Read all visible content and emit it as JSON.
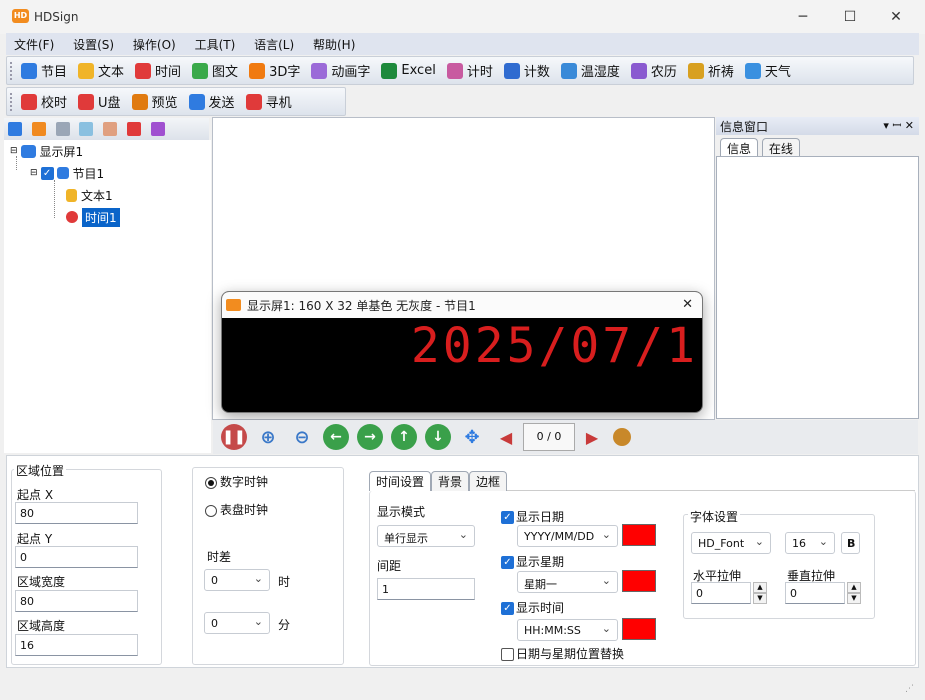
{
  "window": {
    "title": "HDSign",
    "logo": "HD",
    "min": "─",
    "max": "☐",
    "close": "✕"
  },
  "menu": [
    "文件(F)",
    "设置(S)",
    "操作(O)",
    "工具(T)",
    "语言(L)",
    "帮助(H)"
  ],
  "toolbar": [
    {
      "label": "节目",
      "icon": "program-icon",
      "color": "#2f7be0"
    },
    {
      "label": "文本",
      "icon": "text-icon",
      "color": "#f0b428"
    },
    {
      "label": "时间",
      "icon": "clock-icon",
      "color": "#e03a3a"
    },
    {
      "label": "图文",
      "icon": "image-icon",
      "color": "#3aa94a"
    },
    {
      "label": "3D字",
      "icon": "3d-text-icon",
      "color": "#f07a10"
    },
    {
      "label": "动画字",
      "icon": "animated-text-icon",
      "color": "#9b6ad8"
    },
    {
      "label": "Excel",
      "icon": "excel-icon",
      "color": "#1e8a3c"
    },
    {
      "label": "计时",
      "icon": "hourglass-icon",
      "color": "#c85aa0"
    },
    {
      "label": "计数",
      "icon": "counter-icon",
      "color": "#2f6bd0"
    },
    {
      "label": "温湿度",
      "icon": "thermometer-icon",
      "color": "#3a8ad8"
    },
    {
      "label": "农历",
      "icon": "calendar-icon",
      "color": "#8a5ad0"
    },
    {
      "label": "祈祷",
      "icon": "prayer-icon",
      "color": "#d8a020"
    },
    {
      "label": "天气",
      "icon": "weather-icon",
      "color": "#3a90e0"
    }
  ],
  "toolbar2": [
    {
      "label": "校时",
      "icon": "sync-time-icon",
      "color": "#e03a3a"
    },
    {
      "label": "U盘",
      "icon": "usb-icon",
      "color": "#e03a3a"
    },
    {
      "label": "预览",
      "icon": "eye-icon",
      "color": "#e07a10"
    },
    {
      "label": "发送",
      "icon": "send-icon",
      "color": "#2f7be0"
    },
    {
      "label": "寻机",
      "icon": "search-icon",
      "color": "#e03a3a"
    }
  ],
  "tree": {
    "screen": "显示屏1",
    "program": "节目1",
    "items": [
      "文本1",
      "时间1"
    ]
  },
  "info": {
    "title": "信息窗口",
    "tabs": [
      "信息",
      "在线"
    ],
    "pin": "▾ ꟷ ✕"
  },
  "preview": {
    "title": "显示屏1: 160 X 32  单基色 无灰度 - 节目1",
    "led_text": "2025/07/1",
    "close": "✕"
  },
  "nav": {
    "page": "0 / 0"
  },
  "region": {
    "title": "区域位置",
    "x_label": "起点 X",
    "x": "80",
    "y_label": "起点 Y",
    "y": "0",
    "w_label": "区域宽度",
    "w": "80",
    "h_label": "区域高度",
    "h": "16"
  },
  "clock": {
    "digital": "数字时钟",
    "dial": "表盘时钟",
    "offset_label": "时差",
    "hour_value": "0",
    "hour_unit": "时",
    "minute_value": "0",
    "minute_unit": "分"
  },
  "tabs": [
    "时间设置",
    "背景",
    "边框"
  ],
  "timeset": {
    "mode_label": "显示模式",
    "mode_value": "单行显示",
    "spacing_label": "间距",
    "spacing_value": "1",
    "show_date": "显示日期",
    "date_format": "YYYY/MM/DD",
    "show_week": "显示星期",
    "week_format": "星期一",
    "show_time": "显示时间",
    "time_format": "HH:MM:SS",
    "swap": "日期与星期位置替换",
    "swatch_color": "#ff0000"
  },
  "font": {
    "title": "字体设置",
    "name": "HD_Font",
    "size": "16",
    "bold": "B",
    "hstretch_label": "水平拉伸",
    "hstretch": "0",
    "vstretch_label": "垂直拉伸",
    "vstretch": "0"
  }
}
